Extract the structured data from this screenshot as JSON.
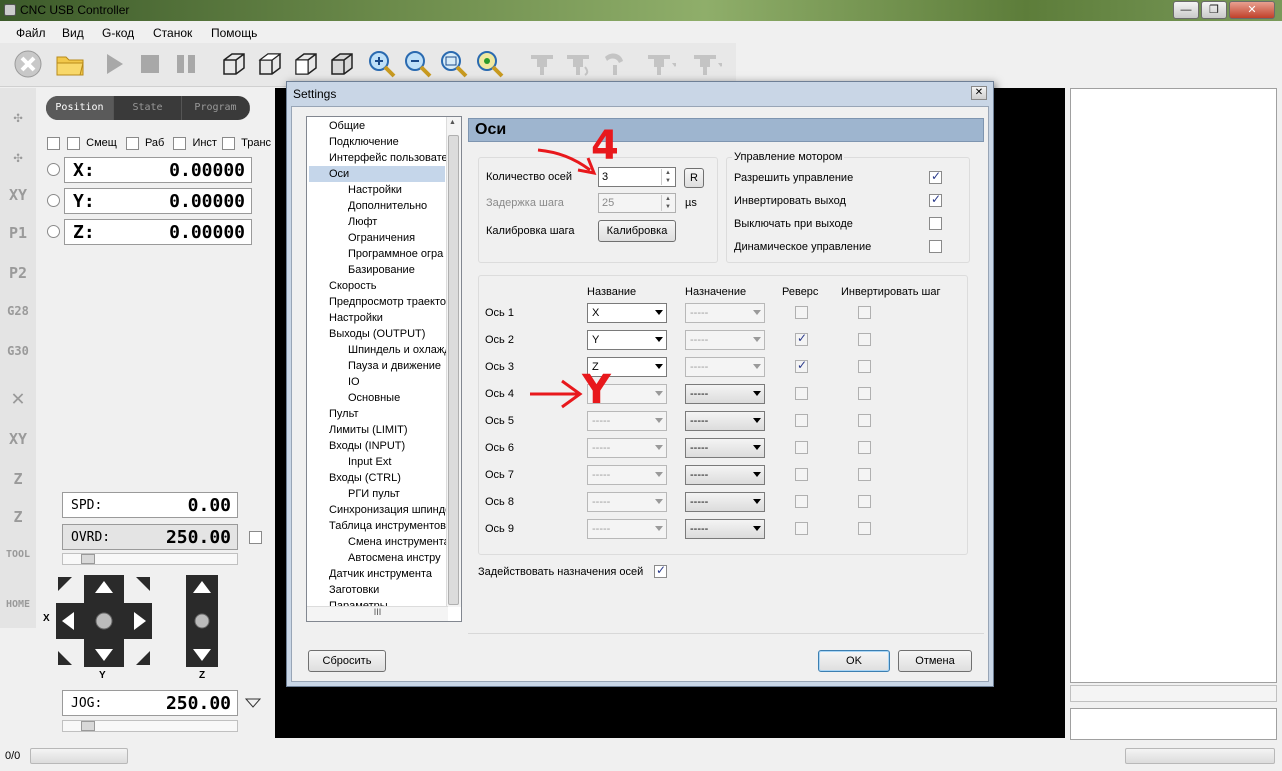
{
  "window": {
    "title": "CNC USB Controller",
    "btn_min": "—",
    "btn_max": "❐",
    "btn_close": "✕"
  },
  "menu": [
    "Файл",
    "Вид",
    "G-код",
    "Станок",
    "Помощь"
  ],
  "left": {
    "tabs": [
      "Position",
      "State",
      "Program"
    ],
    "offset_checks": [
      {
        "label": "Смещ",
        "checked": false
      },
      {
        "label": "Раб",
        "checked": false
      },
      {
        "label": "Инст",
        "checked": false
      },
      {
        "label": "Транс",
        "checked": false
      }
    ],
    "axes": [
      {
        "label": "X:",
        "value": "0.00000"
      },
      {
        "label": "Y:",
        "value": "0.00000"
      },
      {
        "label": "Z:",
        "value": "0.00000"
      }
    ],
    "side_buttons": [
      "XY",
      "P1",
      "P2",
      "G28",
      "G30",
      "XY",
      "Z",
      "Z",
      "TOOL",
      "HOME"
    ],
    "spd_label": "SPD:",
    "spd_value": "0.00",
    "ovrd_label": "OVRD:",
    "ovrd_value": "250.00",
    "jog_label": "JOG:",
    "jog_value": "250.00",
    "pad_x_label": "X",
    "pad_y_label": "Y",
    "pad_z_label": "Z"
  },
  "status": {
    "counter": "0/0"
  },
  "settings": {
    "title": "Settings",
    "section_title": "Оси",
    "tree": [
      {
        "label": "Общие",
        "level": 0
      },
      {
        "label": "Подключение",
        "level": 0
      },
      {
        "label": "Интерфейс пользовате",
        "level": 0
      },
      {
        "label": "Оси",
        "level": 0,
        "selected": true
      },
      {
        "label": "Настройки",
        "level": 1
      },
      {
        "label": "Дополнительно",
        "level": 1
      },
      {
        "label": "Люфт",
        "level": 1
      },
      {
        "label": "Ограничения",
        "level": 1
      },
      {
        "label": "Программное огра",
        "level": 1
      },
      {
        "label": "Базирование",
        "level": 1
      },
      {
        "label": "Скорость",
        "level": 0
      },
      {
        "label": "Предпросмотр траекто",
        "level": 0
      },
      {
        "label": "Настройки",
        "level": 0
      },
      {
        "label": "Выходы (OUTPUT)",
        "level": 0
      },
      {
        "label": "Шпиндель и охлажд",
        "level": 1
      },
      {
        "label": "Пауза и движение",
        "level": 1
      },
      {
        "label": "IO",
        "level": 1
      },
      {
        "label": "Основные",
        "level": 1
      },
      {
        "label": "Пульт",
        "level": 0
      },
      {
        "label": "Лимиты (LIMIT)",
        "level": 0
      },
      {
        "label": "Входы (INPUT)",
        "level": 0
      },
      {
        "label": "Input Ext",
        "level": 1
      },
      {
        "label": "Входы (CTRL)",
        "level": 0
      },
      {
        "label": "РГИ пульт",
        "level": 1
      },
      {
        "label": "Синхронизация шпинде",
        "level": 0
      },
      {
        "label": "Таблица инструментов",
        "level": 0
      },
      {
        "label": "Смена инструмента",
        "level": 1
      },
      {
        "label": "Автосмена инстру",
        "level": 1
      },
      {
        "label": "Датчик инструмента",
        "level": 0
      },
      {
        "label": "Заготовки",
        "level": 0
      },
      {
        "label": "Параметры",
        "level": 0
      }
    ],
    "tree_hscroll": "III",
    "axis_count_label": "Количество осей",
    "axis_count_value": "3",
    "r_button": "R",
    "step_delay_label": "Задержка шага",
    "step_delay_value": "25",
    "step_delay_unit": "µs",
    "calib_label": "Калибровка шага",
    "calib_button": "Калибровка",
    "motor_group_title": "Управление мотором",
    "motor_options": [
      {
        "label": "Разрешить управление",
        "checked": true
      },
      {
        "label": "Инвертировать выход",
        "checked": true
      },
      {
        "label": "Выключать при выходе",
        "checked": false
      },
      {
        "label": "Динамическое управление",
        "checked": false
      }
    ],
    "col_name": "Название",
    "col_assign": "Назначение",
    "col_reverse": "Реверс",
    "col_invert": "Инвертировать шаг",
    "axes": [
      {
        "label": "Ось 1",
        "name": "X",
        "name_enabled": true,
        "assign": "-----",
        "assign_enabled": false,
        "reverse": false,
        "invert": false
      },
      {
        "label": "Ось 2",
        "name": "Y",
        "name_enabled": true,
        "assign": "-----",
        "assign_enabled": false,
        "reverse": true,
        "invert": false
      },
      {
        "label": "Ось 3",
        "name": "Z",
        "name_enabled": true,
        "assign": "-----",
        "assign_enabled": false,
        "reverse": true,
        "invert": false
      },
      {
        "label": "Ось 4",
        "name": "",
        "name_enabled": false,
        "assign": "-----",
        "assign_enabled": true,
        "reverse": false,
        "invert": false
      },
      {
        "label": "Ось 5",
        "name": "-----",
        "name_enabled": false,
        "assign": "-----",
        "assign_enabled": true,
        "reverse": false,
        "invert": false
      },
      {
        "label": "Ось 6",
        "name": "-----",
        "name_enabled": false,
        "assign": "-----",
        "assign_enabled": true,
        "reverse": false,
        "invert": false
      },
      {
        "label": "Ось 7",
        "name": "-----",
        "name_enabled": false,
        "assign": "-----",
        "assign_enabled": true,
        "reverse": false,
        "invert": false
      },
      {
        "label": "Ось 8",
        "name": "-----",
        "name_enabled": false,
        "assign": "-----",
        "assign_enabled": true,
        "reverse": false,
        "invert": false
      },
      {
        "label": "Ось 9",
        "name": "-----",
        "name_enabled": false,
        "assign": "-----",
        "assign_enabled": true,
        "reverse": false,
        "invert": false
      }
    ],
    "use_assign_label": "Задействовать назначения осей",
    "use_assign_checked": true,
    "reset_button": "Сбросить",
    "ok_button": "OK",
    "cancel_button": "Отмена"
  },
  "annotations": {
    "count_mark": "4",
    "axis4_mark": "Y",
    "arrow_color": "#e8181c"
  }
}
